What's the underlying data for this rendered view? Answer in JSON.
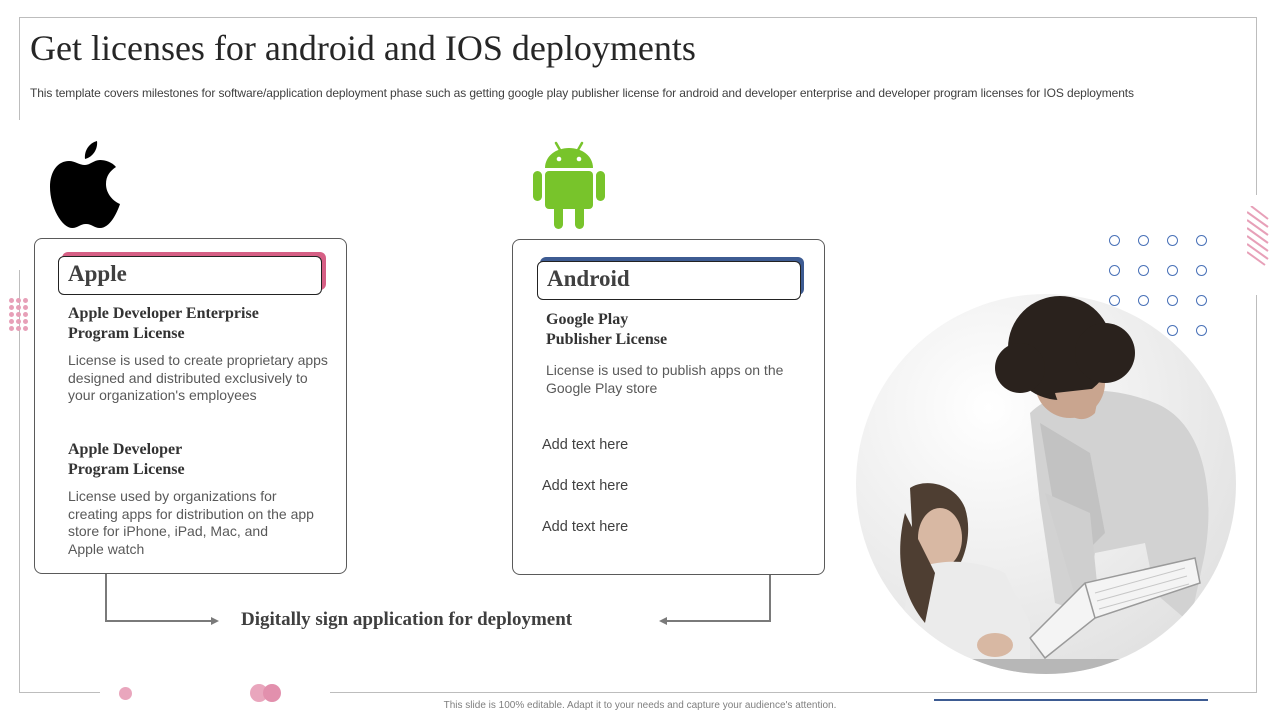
{
  "slide": {
    "title": "Get licenses for android and IOS deployments",
    "subtitle": "This template covers milestones for software/application deployment phase such as getting google play publisher license for android and developer enterprise and developer program licenses for IOS  deployments",
    "footer": "This slide is 100% editable. Adapt it to your needs and capture your audience's attention."
  },
  "apple_card": {
    "icon": "apple-logo-icon",
    "tab_label": "Apple",
    "accent_color": "#d65f85",
    "items": [
      {
        "heading_line1": "Apple Developer Enterprise",
        "heading_line2": "Program License",
        "body_line1": "License is used to create proprietary  apps",
        "body_line2": "designed and distributed exclusively to",
        "body_line3": "your  organization's employees"
      },
      {
        "heading_line1": "Apple Developer",
        "heading_line2": "Program License",
        "body_line1": "License used by  organizations for",
        "body_line2": "creating  apps for distribution on the  app",
        "body_line3": "store for iPhone, iPad, Mac, and",
        "body_line4": "Apple watch"
      }
    ]
  },
  "android_card": {
    "icon": "android-logo-icon",
    "icon_color": "#78c42b",
    "tab_label": "Android",
    "accent_color": "#3d5b92",
    "heading_line1": "Google Play",
    "heading_line2": "Publisher License",
    "body_line1": "License  is used  to  publish  apps on  the",
    "body_line2": "Google Play store",
    "placeholders": [
      "Add text here",
      "Add text here",
      "Add text here"
    ]
  },
  "bottom_step": {
    "label": "Digitally sign application for deployment"
  },
  "decor": {
    "photo": "students-reading-book-photo"
  }
}
